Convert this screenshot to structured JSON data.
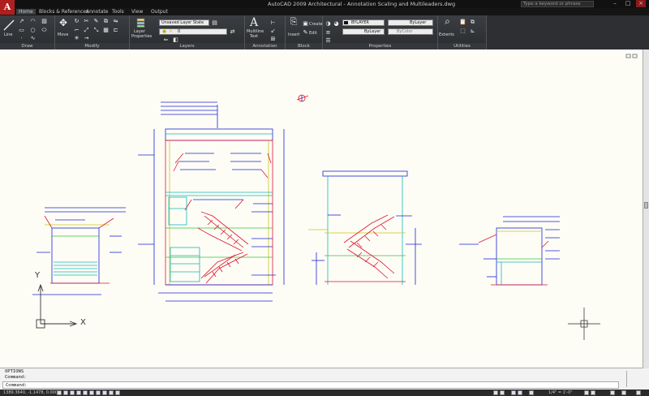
{
  "app": {
    "logo": "A",
    "title": "AutoCAD 2009   Architectural - Annotation Scaling and Multileaders.dwg",
    "search_placeholder": "Type a keyword or phrase"
  },
  "menu": [
    "Home",
    "Blocks & References",
    "Annotate",
    "Tools",
    "View",
    "Output"
  ],
  "ribbon": {
    "draw": {
      "label": "Draw",
      "line": "Line"
    },
    "modify": {
      "label": "Modify",
      "move": "Move"
    },
    "layers": {
      "label": "Layers",
      "layer_props": [
        "Layer",
        "Properties"
      ],
      "layer_state": "Unsaved Layer State",
      "current_layer": "0"
    },
    "annotation": {
      "label": "Annotation",
      "mtext": [
        "Multiline",
        "Text"
      ]
    },
    "block": {
      "label": "Block",
      "insert": "Insert",
      "create": "Create",
      "edit": "Edit"
    },
    "properties": {
      "label": "Properties",
      "color": "BYLAYER",
      "linetype": "ByLayer",
      "lineweight": "ByLayer",
      "plotstyle": "ByColor"
    },
    "utilities": {
      "label": "Utilities",
      "zoom": "Extents"
    }
  },
  "ucs": {
    "x": "X",
    "y": "Y"
  },
  "command": {
    "history": [
      "OPTIONS",
      "Command:"
    ],
    "prompt": "Command:"
  },
  "status": {
    "coords": "1389.3640, -1.1478, 0.0000",
    "scale": "1/4\" = 1'-0\""
  },
  "colors": {
    "cad_red": "#e0142d",
    "cad_blue": "#1b23d6",
    "cad_cyan": "#16b6b6",
    "cad_green": "#3cbf3c",
    "cad_yellow": "#cfc21d",
    "paper": "#fdfdf6"
  }
}
